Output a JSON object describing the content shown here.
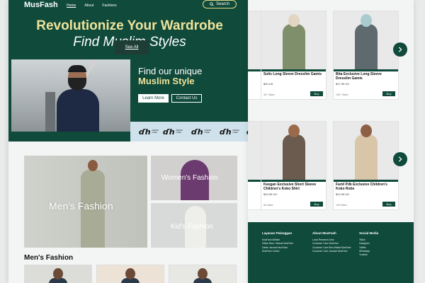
{
  "brand": {
    "name": "MusFash"
  },
  "nav": {
    "links": [
      "Home",
      "About",
      "Fashions"
    ],
    "search_label": "Search"
  },
  "hero": {
    "title_line1": "Revolutionize Your Wardrobe",
    "title_line2": "Find Muslim Styles",
    "cta_title": "Find our unique",
    "cta_highlight": "Muslim Style",
    "btn_learn": "Learn More",
    "btn_contact": "Contact Us"
  },
  "brand_strip": {
    "mark": "ɗh",
    "tagline": "DESIGN CODE"
  },
  "categories": {
    "men": "Men's Fashion",
    "women": "Women's Fashion",
    "kid": "Kid's Fashion",
    "see_all": "See All"
  },
  "section_title": "Men's Fashion",
  "products": [
    {
      "name": "Sulis Long Sleeve Dresslim Gamis",
      "price": "$20 US",
      "sales": "3k+ Sales",
      "buy": "Buy"
    },
    {
      "name": "Bita Exclusive Long Sleeve Dresslim Gamis",
      "price": "$17.99 US",
      "sales": "100+ Sales",
      "buy": "Buy"
    },
    {
      "name": "Keegan Exclusive Short Sleeve Children's Koko Shirt",
      "price": "$10.99 US",
      "sales": "5k Sales",
      "buy": "Buy"
    },
    {
      "name": "Farid Pdk Exclusive Children's Koko Robe",
      "price": "$12.99 US",
      "sales": "100 Sales",
      "buy": "Buy"
    }
  ],
  "footer": {
    "col1_title": "Layanan Pelanggan",
    "col1_links": [
      "MusFash Affiliate",
      "Daftar Baru / Masuk MusFash",
      "Daftar Jamaah MusFash",
      "MusFash Career"
    ],
    "col2_title": "About MusFash",
    "col2_links": [
      "Local Research Area",
      "Customer Care MusFash",
      "Customer Care Bina Wakaf MusFash",
      "Customer Care Jamaah MusFash"
    ],
    "col3_title": "Social Media",
    "col3_links": [
      "Tiktok",
      "Instagram",
      "Twitter",
      "WhatsApp",
      "Youtube"
    ]
  },
  "colors": {
    "primary": "#0f4a3a",
    "accent": "#efe39b",
    "background": "#e9ebea"
  }
}
